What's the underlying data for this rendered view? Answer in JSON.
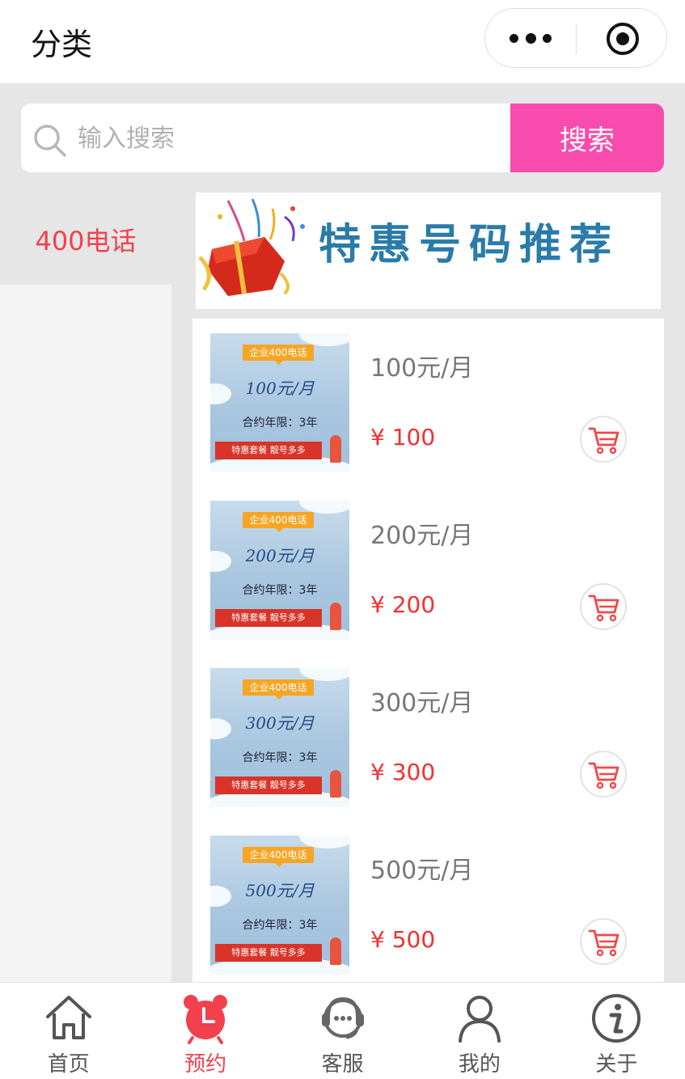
{
  "header": {
    "title": "分类",
    "menu_icon": "more-dots-icon",
    "close_icon": "target-circle-icon"
  },
  "search": {
    "placeholder": "输入搜索",
    "button_label": "搜索"
  },
  "sidebar": {
    "items": [
      {
        "label": "400电话",
        "active": true
      }
    ]
  },
  "banner": {
    "text": "特惠号码推荐"
  },
  "products": [
    {
      "name": "100元/月",
      "price": "¥ 100",
      "thumb": {
        "tag": "企业400电话",
        "headline": "100元/月",
        "term": "合约年限：3年",
        "ribbon": "特惠套餐  靓号多多"
      }
    },
    {
      "name": "200元/月",
      "price": "¥ 200",
      "thumb": {
        "tag": "企业400电话",
        "headline": "200元/月",
        "term": "合约年限：3年",
        "ribbon": "特惠套餐  靓号多多"
      }
    },
    {
      "name": "300元/月",
      "price": "¥ 300",
      "thumb": {
        "tag": "企业400电话",
        "headline": "300元/月",
        "term": "合约年限：3年",
        "ribbon": "特惠套餐  靓号多多"
      }
    },
    {
      "name": "500元/月",
      "price": "¥ 500",
      "thumb": {
        "tag": "企业400电话",
        "headline": "500元/月",
        "term": "合约年限：3年",
        "ribbon": "特惠套餐  靓号多多"
      }
    }
  ],
  "tabbar": {
    "items": [
      {
        "label": "首页",
        "icon": "home-icon",
        "active": false
      },
      {
        "label": "预约",
        "icon": "alarm-clock-icon",
        "active": true
      },
      {
        "label": "客服",
        "icon": "customer-service-icon",
        "active": false
      },
      {
        "label": "我的",
        "icon": "user-icon",
        "active": false
      },
      {
        "label": "关于",
        "icon": "info-icon",
        "active": false
      }
    ]
  },
  "colors": {
    "accent_pink": "#f74cad",
    "active_red": "#f2404e",
    "price_red": "#f23030",
    "banner_blue": "#2a7ba8"
  }
}
